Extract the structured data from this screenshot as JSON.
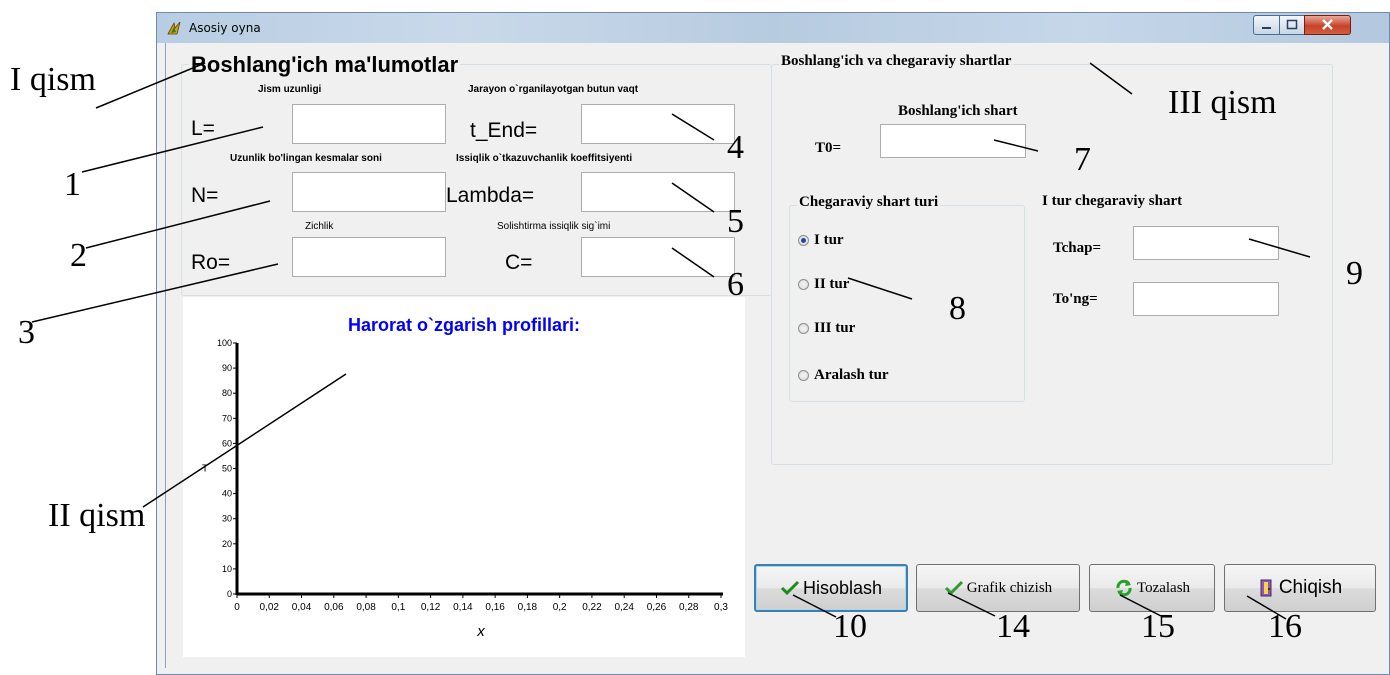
{
  "window": {
    "title": "Asosiy oyna"
  },
  "annotations": {
    "part1": "I qism",
    "part2": "II qism",
    "part3": "III qism",
    "n1": "1",
    "n2": "2",
    "n3": "3",
    "n4": "4",
    "n5": "5",
    "n6": "6",
    "n7": "7",
    "n8": "8",
    "n9": "9",
    "n10": "10",
    "n14": "14",
    "n15": "15",
    "n16": "16"
  },
  "initial_data": {
    "caption": "Boshlang'ich ma'lumotlar",
    "length": {
      "caption": "Jism uzunligi",
      "label": "L=",
      "value": ""
    },
    "t_end": {
      "caption": "Jarayon o`rganilayotgan butun vaqt",
      "label": "t_End=",
      "value": ""
    },
    "segments": {
      "caption": "Uzunlik bo'lingan kesmalar soni",
      "label": "N=",
      "value": ""
    },
    "lambda": {
      "caption": "Issiqlik o`tkazuvchanlik koeffitsiyenti",
      "label": "Lambda=",
      "value": ""
    },
    "density": {
      "caption": "Zichlik",
      "label": "Ro=",
      "value": ""
    },
    "heat_capacity": {
      "caption": "Solishtirma issiqlik sig`imi",
      "label": "C=",
      "value": ""
    }
  },
  "conditions": {
    "caption": "Boshlang'ich va chegaraviy shartlar",
    "initial_caption": "Boshlang'ich shart",
    "t0_label": "T0=",
    "t0_value": "",
    "boundary_type": {
      "caption": "Chegaraviy shart turi",
      "options": [
        "I tur",
        "II tur",
        "III tur",
        "Aralash tur"
      ],
      "selected": "I tur"
    },
    "first_type": {
      "caption": "I tur chegaraviy shart",
      "tchap_label": "Tchap=",
      "tchap_value": "",
      "tong_label": "To'ng=",
      "tong_value": ""
    }
  },
  "buttons": {
    "calculate": "Hisoblash",
    "plot": "Grafik chizish",
    "clear": "Tozalash",
    "exit": "Chiqish"
  },
  "chart_data": {
    "type": "line",
    "title": "Harorat o`zgarish profillari:",
    "xlabel": "x",
    "ylabel": "T",
    "xlim": [
      0,
      0.3
    ],
    "ylim": [
      0,
      100
    ],
    "x_ticks": [
      "0",
      "0,02",
      "0,04",
      "0,06",
      "0,08",
      "0,1",
      "0,12",
      "0,14",
      "0,16",
      "0,18",
      "0,2",
      "0,22",
      "0,24",
      "0,26",
      "0,28",
      "0,3"
    ],
    "y_ticks": [
      "0",
      "10",
      "20",
      "30",
      "40",
      "50",
      "60",
      "70",
      "80",
      "90",
      "100"
    ],
    "series": []
  }
}
